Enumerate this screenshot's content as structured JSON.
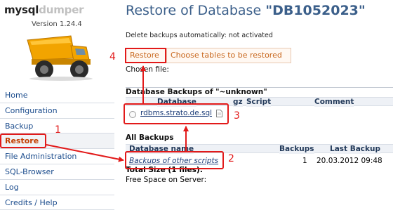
{
  "app": {
    "logo_part1": "mysql",
    "logo_part2": "dumper",
    "version": "Version 1.24.4"
  },
  "sidebar": {
    "items": [
      {
        "label": "Home",
        "active": false
      },
      {
        "label": "Configuration",
        "active": false
      },
      {
        "label": "Backup",
        "active": false
      },
      {
        "label": "Restore",
        "active": true
      },
      {
        "label": "File Administration",
        "active": false
      },
      {
        "label": "SQL-Browser",
        "active": false
      },
      {
        "label": "Log",
        "active": false
      },
      {
        "label": "Credits / Help",
        "active": false
      }
    ]
  },
  "main": {
    "title_prefix": "Restore of Database ",
    "title_db": "\"DB1052023\"",
    "delete_info": "Delete backups automatically: not activated",
    "tabs": [
      {
        "label": "Restore"
      },
      {
        "label": "Choose tables to be restored"
      }
    ],
    "chosen_file": "Chosen file:",
    "db_backups": {
      "title": "Database Backups of \"~unknown\"",
      "columns": {
        "database": "Database",
        "gz": "gz",
        "script": "Script",
        "comment": "Comment"
      },
      "row": {
        "database": "rdbms.strato.de.sql"
      }
    },
    "all_backups": {
      "title": "All Backups",
      "columns": {
        "database_name": "Database name",
        "backups": "Backups",
        "last_backup": "Last Backup"
      },
      "row": {
        "name": "Backups of other scripts",
        "count": "1",
        "last_backup": "20.03.2012 09:48"
      },
      "total_size": "Total Size (1 files):",
      "free_space": "Free Space on Server:"
    }
  },
  "annotations": {
    "numbers": [
      "1",
      "2",
      "3",
      "4"
    ],
    "color": "#e21a1a"
  },
  "colors": {
    "accent_title": "#3b5f8a",
    "nav_link": "#1a4b8c",
    "nav_active": "#c43d00",
    "tab_text": "#c8671d"
  }
}
